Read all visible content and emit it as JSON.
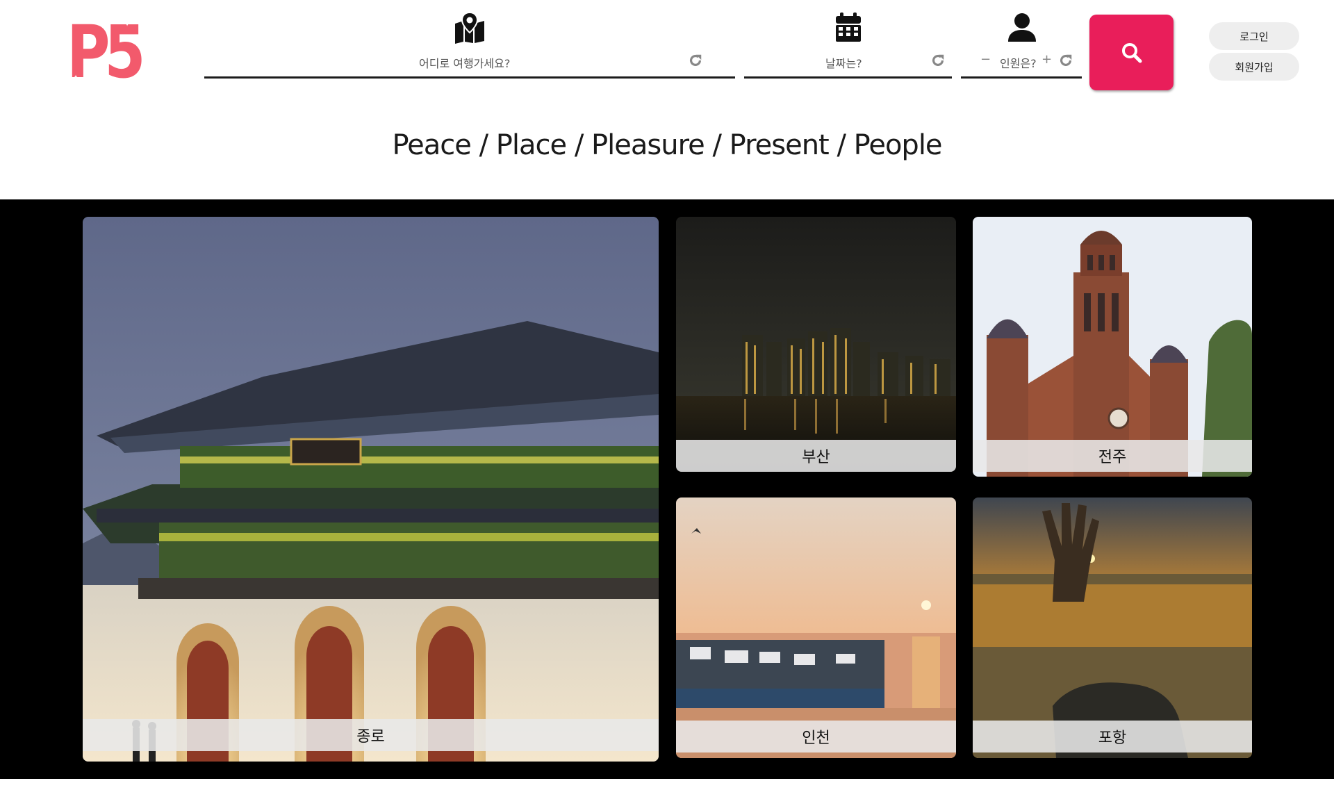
{
  "brand": {
    "logo_text": "P5",
    "logo_color": "#f25a6c"
  },
  "search": {
    "destination_placeholder": "어디로 여행가세요?",
    "date_placeholder": "날짜는?",
    "guests_placeholder": "인원은?",
    "guests_minus": "−",
    "guests_plus": "+",
    "button_icon": "search-icon",
    "button_color": "#e91e5a"
  },
  "auth": {
    "login_label": "로그인",
    "signup_label": "회원가입"
  },
  "tagline": "Peace / Place / Pleasure / Present / People",
  "destinations": [
    {
      "label": "종로",
      "image": "gyeongbokgung-gate-night"
    },
    {
      "label": "부산",
      "image": "busan-skyline-night"
    },
    {
      "label": "전주",
      "image": "jeonju-cathedral"
    },
    {
      "label": "인천",
      "image": "incheon-harbor-sunset"
    },
    {
      "label": "포항",
      "image": "pohang-hand-sculpture-sunrise"
    }
  ]
}
